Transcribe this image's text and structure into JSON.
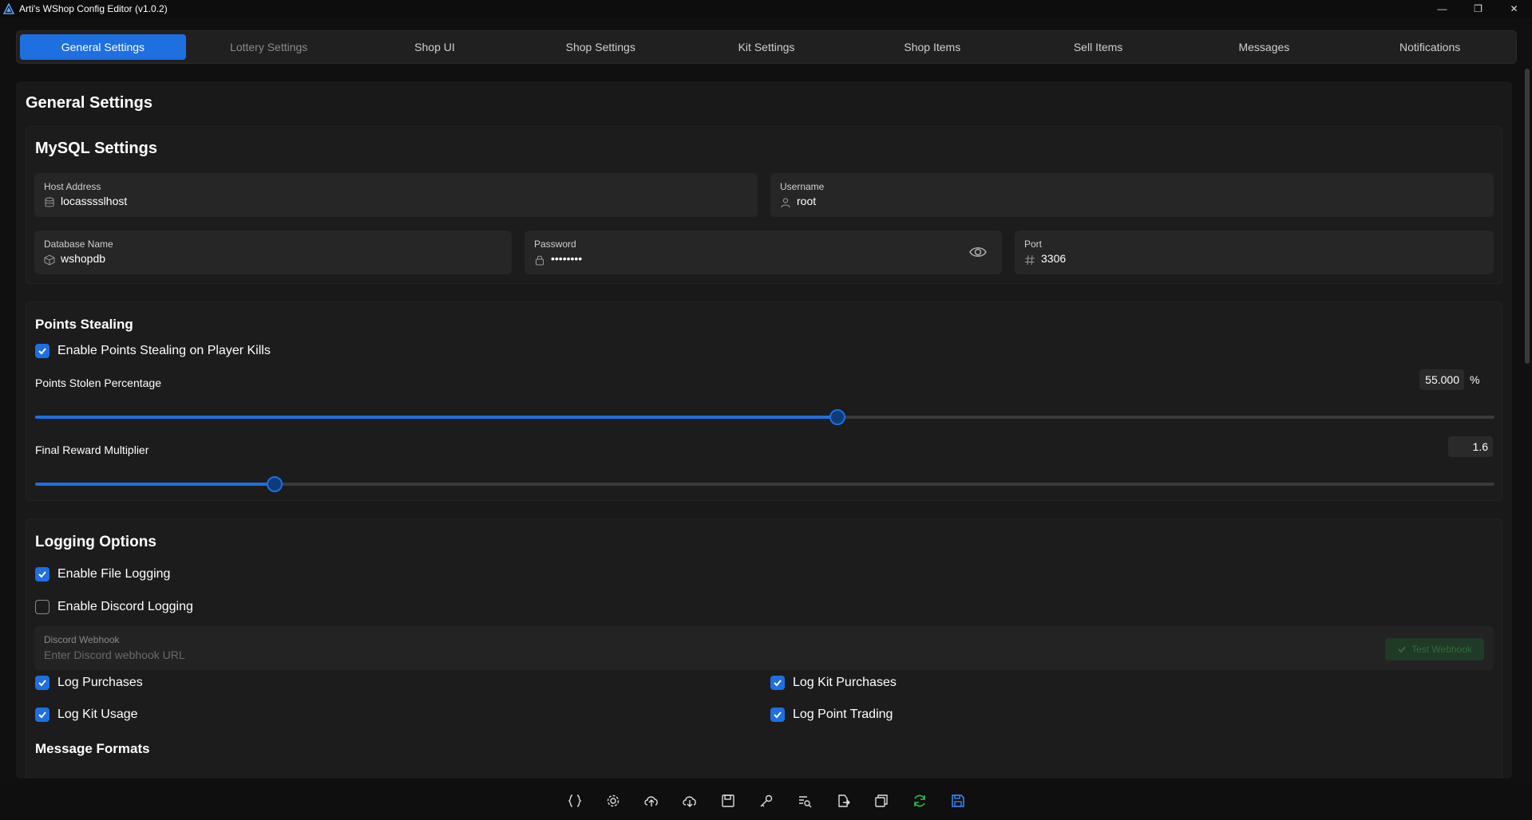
{
  "window": {
    "title": "Arti's WShop Config Editor (v1.0.2)",
    "minimize": "—",
    "maximize": "❐",
    "close": "✕"
  },
  "tabs": [
    {
      "label": "General Settings"
    },
    {
      "label": "Lottery Settings"
    },
    {
      "label": "Shop UI"
    },
    {
      "label": "Shop Settings"
    },
    {
      "label": "Kit Settings"
    },
    {
      "label": "Shop Items"
    },
    {
      "label": "Sell Items"
    },
    {
      "label": "Messages"
    },
    {
      "label": "Notifications"
    }
  ],
  "page_title": "General Settings",
  "mysql": {
    "title": "MySQL Settings",
    "host_label": "Host Address",
    "host_value": "locasssslhost",
    "username_label": "Username",
    "username_value": "root",
    "db_label": "Database Name",
    "db_value": "wshopdb",
    "password_label": "Password",
    "password_value": "••••••••",
    "port_label": "Port",
    "port_value": "3306"
  },
  "points": {
    "title": "Points Stealing",
    "enable_label": "Enable Points Stealing on Player Kills",
    "enable_checked": true,
    "pct_label": "Points Stolen Percentage",
    "pct_value": "55.000",
    "pct_unit": "%",
    "pct_fraction": 0.55,
    "mult_label": "Final Reward Multiplier",
    "mult_value": "1.6",
    "mult_fraction": 0.164
  },
  "logging": {
    "title": "Logging Options",
    "file_label": "Enable File Logging",
    "file_checked": true,
    "discord_label": "Enable Discord Logging",
    "discord_checked": false,
    "webhook_label": "Discord Webhook",
    "webhook_placeholder": "Enter Discord webhook URL",
    "test_label": "Test Webhook",
    "purchases_label": "Log Purchases",
    "kit_purchases_label": "Log Kit Purchases",
    "kit_usage_label": "Log Kit Usage",
    "point_trading_label": "Log Point Trading"
  },
  "message_formats_title": "Message Formats",
  "toolbar": [
    "braces-icon",
    "settings-icon",
    "upload-cloud-icon",
    "download-cloud-icon",
    "save-file-icon",
    "key-icon",
    "search-doc-icon",
    "export-icon",
    "copy-icon",
    "refresh-icon",
    "save-icon"
  ],
  "colors": {
    "accent": "#1e6fe0",
    "refresh": "#27c24c",
    "save": "#3b82f6"
  }
}
